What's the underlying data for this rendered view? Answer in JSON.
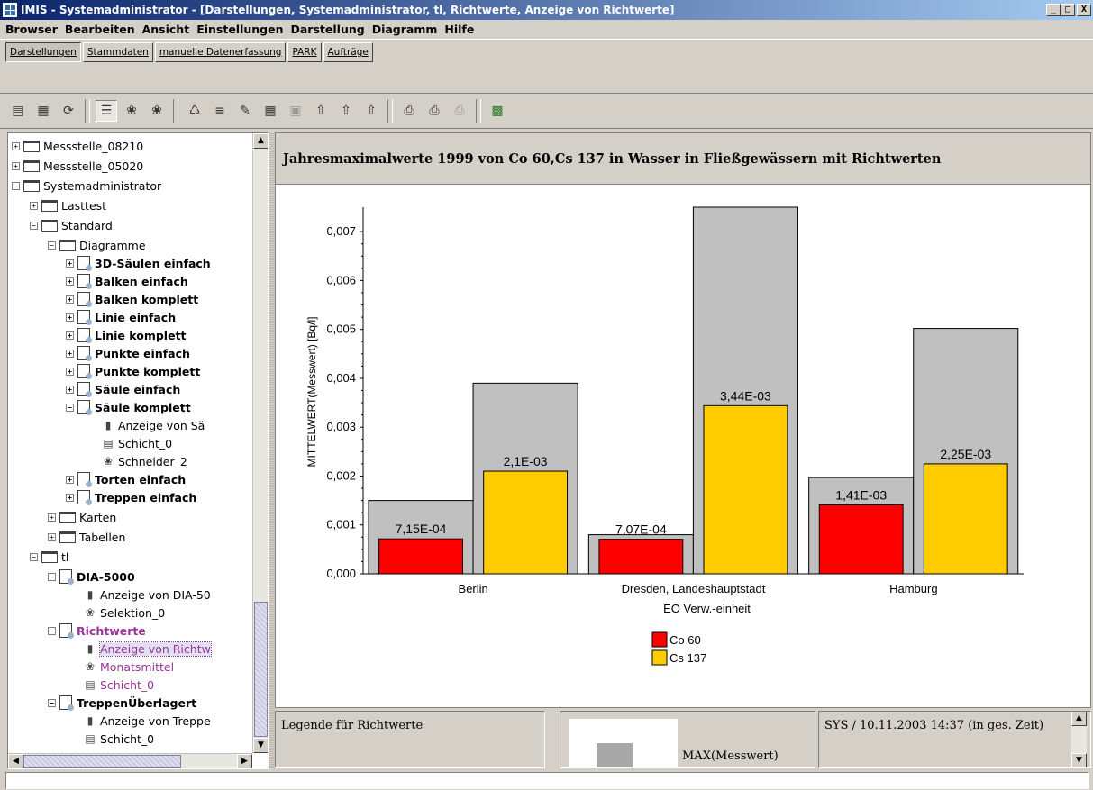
{
  "window": {
    "title": "IMIS - Systemadministrator - [Darstellungen, Systemadministrator, tl, Richtwerte, Anzeige von Richtwerte]",
    "minimize": "_",
    "maximize": "□",
    "close": "X"
  },
  "menu": [
    "Browser",
    "Bearbeiten",
    "Ansicht",
    "Einstellungen",
    "Darstellung",
    "Diagramm",
    "Hilfe"
  ],
  "nav_tabs": [
    "Darstellungen",
    "Stammdaten",
    "manuelle Datenerfassung",
    "PARK",
    "Aufträge"
  ],
  "toolbar_icons": [
    "save-icon",
    "save-all-icon",
    "refresh-icon",
    "layer-icon",
    "filter-icon",
    "filter2-icon",
    "link-icon",
    "list-icon",
    "edit-icon",
    "table-icon",
    "frame-icon",
    "export1-icon",
    "export2-icon",
    "export3-icon",
    "print-icon",
    "print-preview-icon",
    "print-disabled-icon",
    "chart-icon"
  ],
  "tree": [
    {
      "label": "Messstelle_08210"
    },
    {
      "label": "Messstelle_05020"
    },
    {
      "label": "Systemadministrator"
    },
    {
      "label": "Lasttest"
    },
    {
      "label": "Standard"
    },
    {
      "label": "Diagramme"
    },
    {
      "label": "3D-Säulen einfach"
    },
    {
      "label": "Balken einfach"
    },
    {
      "label": "Balken komplett"
    },
    {
      "label": "Linie einfach"
    },
    {
      "label": "Linie komplett"
    },
    {
      "label": "Punkte einfach"
    },
    {
      "label": "Punkte komplett"
    },
    {
      "label": "Säule einfach"
    },
    {
      "label": "Säule komplett"
    },
    {
      "label": "Anzeige von Sä"
    },
    {
      "label": "Schicht_0"
    },
    {
      "label": "Schneider_2"
    },
    {
      "label": "Torten einfach"
    },
    {
      "label": "Treppen einfach"
    },
    {
      "label": "Karten"
    },
    {
      "label": "Tabellen"
    },
    {
      "label": "tl"
    },
    {
      "label": "DIA-5000"
    },
    {
      "label": "Anzeige von DIA-50"
    },
    {
      "label": "Selektion_0"
    },
    {
      "label": "Richtwerte"
    },
    {
      "label": "Anzeige von Richtw"
    },
    {
      "label": "Monatsmittel"
    },
    {
      "label": "Schicht_0"
    },
    {
      "label": "TreppenÜberlagert"
    },
    {
      "label": "Anzeige von Treppe"
    },
    {
      "label": "Schicht_0"
    }
  ],
  "chart_title": "Jahresmaximalwerte 1999 von Co 60,Cs 137 in Wasser in Fließgewässern mit Richtwerten",
  "chart_data": {
    "type": "bar",
    "categories": [
      "Berlin",
      "Dresden, Landeshauptstadt",
      "Hamburg"
    ],
    "series": [
      {
        "name": "Co 60",
        "color": "#ff0000",
        "values": [
          0.000715,
          0.000707,
          0.00141
        ],
        "labels": [
          "7,15E-04",
          "7,07E-04",
          "1,41E-03"
        ]
      },
      {
        "name": "Cs 137",
        "color": "#ffcc00",
        "values": [
          0.0021,
          0.00344,
          0.00225
        ],
        "labels": [
          "2,1E-03",
          "3,44E-03",
          "2,25E-03"
        ]
      }
    ],
    "richtwerte": {
      "color": "#c0c0c0",
      "values": [
        [
          0.0015,
          0.0039
        ],
        [
          0.0008,
          0.0075
        ],
        [
          0.00197,
          0.00502
        ]
      ]
    },
    "ylabel": "MITTELWERT(Messwert) [Bq/l]",
    "xlabel": "EO Verw.-einheit",
    "ylim": [
      0,
      0.0075
    ],
    "yticks": [
      "0,000",
      "0,001",
      "0,002",
      "0,003",
      "0,004",
      "0,005",
      "0,006",
      "0,007"
    ],
    "legend_position": "bottom-center"
  },
  "footer": {
    "legend_label": "Legende für Richtwerte",
    "legend_item": "MAX(Messwert)",
    "status": "SYS / 10.11.2003 14:37 (in ges. Zeit)"
  }
}
